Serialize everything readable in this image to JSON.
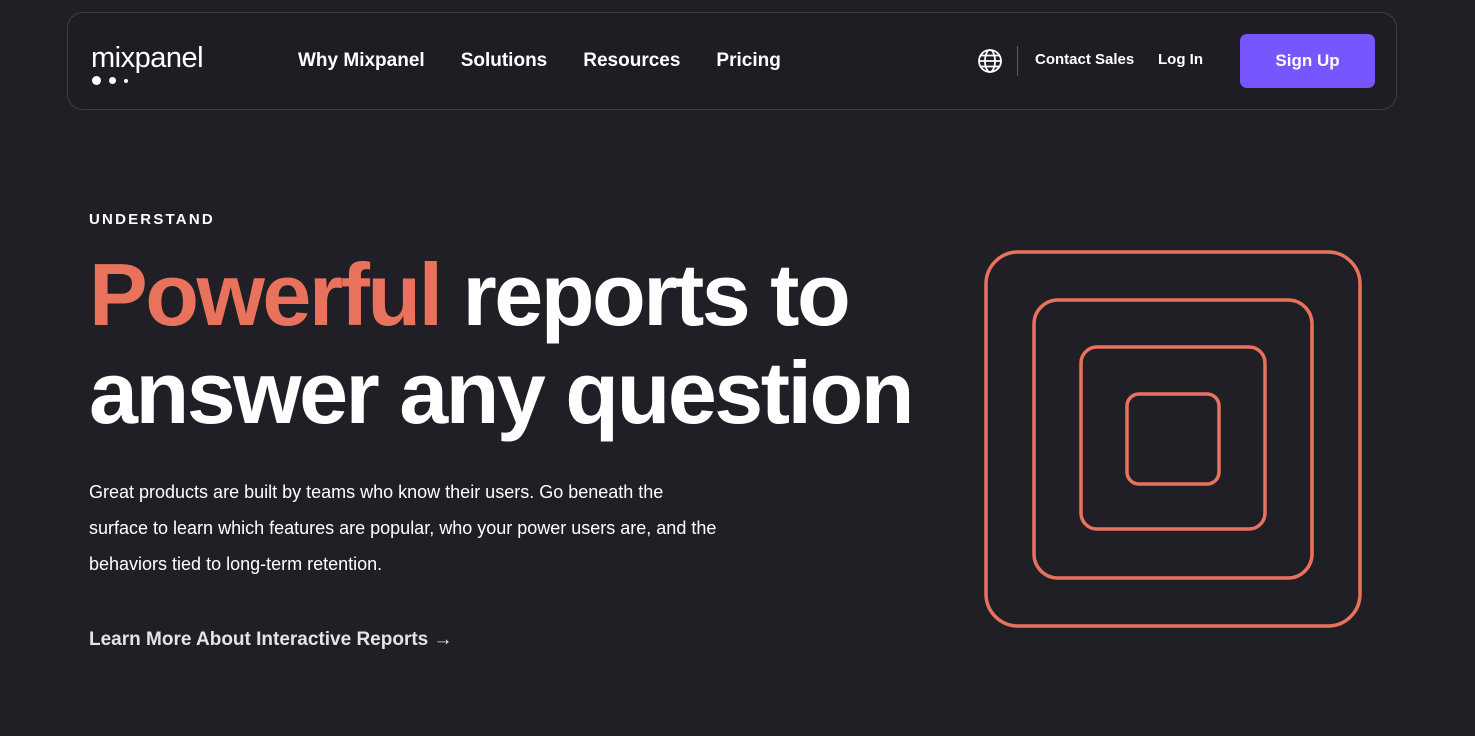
{
  "header": {
    "logo_text": "mixpanel",
    "nav": [
      {
        "label": "Why Mixpanel"
      },
      {
        "label": "Solutions"
      },
      {
        "label": "Resources"
      },
      {
        "label": "Pricing"
      }
    ],
    "language_icon": "globe-icon",
    "contact_label": "Contact Sales",
    "login_label": "Log In",
    "signup_label": "Sign Up"
  },
  "hero": {
    "eyebrow": "UNDERSTAND",
    "headline_accent": "Powerful",
    "headline_line1_rest": " reports to",
    "headline_line2": "answer any question",
    "body": "Great products are built by teams who know their users. Go beneath the surface to learn which features are popular, who your power users are, and the behaviors tied to long-term retention.",
    "cta_label": "Learn More About Interactive Reports →",
    "illustration": "nested-squares-graphic"
  },
  "colors": {
    "background": "#211f26",
    "accent": "#e8725c",
    "button": "#7856ff",
    "text": "#ffffff"
  }
}
